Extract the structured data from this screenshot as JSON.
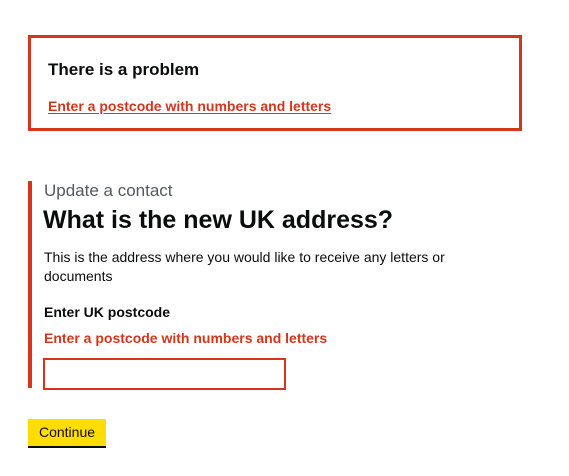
{
  "error_summary": {
    "title": "There is a problem",
    "link": "Enter a postcode with numbers and letters"
  },
  "caption": "Update a contact",
  "heading": "What is the new UK address?",
  "hint": "This is the address where you would like to receive any letters or documents",
  "postcode": {
    "label": "Enter UK postcode",
    "error": "Enter a postcode with numbers and letters",
    "value": ""
  },
  "continue_label": "Continue",
  "colors": {
    "error": "#d4351c",
    "button": "#ffdd00",
    "text": "#0b0c0c",
    "secondary_text": "#505a5f"
  }
}
